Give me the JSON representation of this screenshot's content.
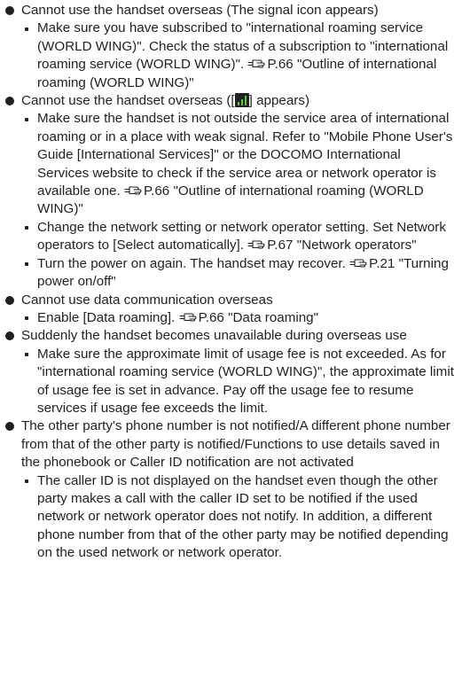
{
  "items": [
    {
      "heading": "Cannot use the handset overseas (The signal icon appears)",
      "subs": [
        {
          "before": "Make sure you have subscribed to \"international roaming service (WORLD WING)\". Check the status of a subscription to \"international roaming service (WORLD WING)\". ",
          "ref": "P.66 \"Outline of international roaming (WORLD WING)\""
        }
      ]
    },
    {
      "heading_before": "Cannot use the handset overseas ([",
      "heading_after": "] appears)",
      "heading_icon": "no-service-signal-icon",
      "subs": [
        {
          "before": "Make sure the handset is not outside the service area of international roaming or in a place with weak signal. Refer to \"Mobile Phone User's Guide [International Services]\" or the DOCOMO International Services website to check if the service area or network operator is available one. ",
          "ref": "P.66 \"Outline of international roaming (WORLD WING)\""
        },
        {
          "before": "Change the network setting or network operator setting. Set Network operators to [Select automatically]. ",
          "ref": "P.67 \"Network operators\""
        },
        {
          "before": "Turn the power on again. The handset may recover. ",
          "ref": "P.21 \"Turning power on/off\""
        }
      ]
    },
    {
      "heading": "Cannot use data communication overseas",
      "subs": [
        {
          "before": "Enable [Data roaming]. ",
          "ref": "P.66 \"Data roaming\""
        }
      ]
    },
    {
      "heading": "Suddenly the handset becomes unavailable during overseas use",
      "subs": [
        {
          "before": "Make sure the approximate limit of usage fee is not exceeded. As for \"international roaming service (WORLD WING)\", the approximate limit of usage fee is set in advance. Pay off the usage fee to resume services if usage fee exceeds the limit.",
          "ref": ""
        }
      ]
    },
    {
      "heading": "The other party's phone number is not notified/A different phone number from that of the other party is notified/Functions to use details saved in the phonebook or Caller ID notification are not activated",
      "subs": [
        {
          "before": "The caller ID is not displayed on the handset even though the other party makes a call with the caller ID set to be notified if the used network or network operator does not notify. In addition, a different phone number from that of the other party may be notified depending on the used network or network operator.",
          "ref": ""
        }
      ]
    }
  ],
  "ref_icon": "page-reference-hand-icon",
  "colors": {
    "text": "#231f20",
    "signal": "#5ec24a"
  }
}
